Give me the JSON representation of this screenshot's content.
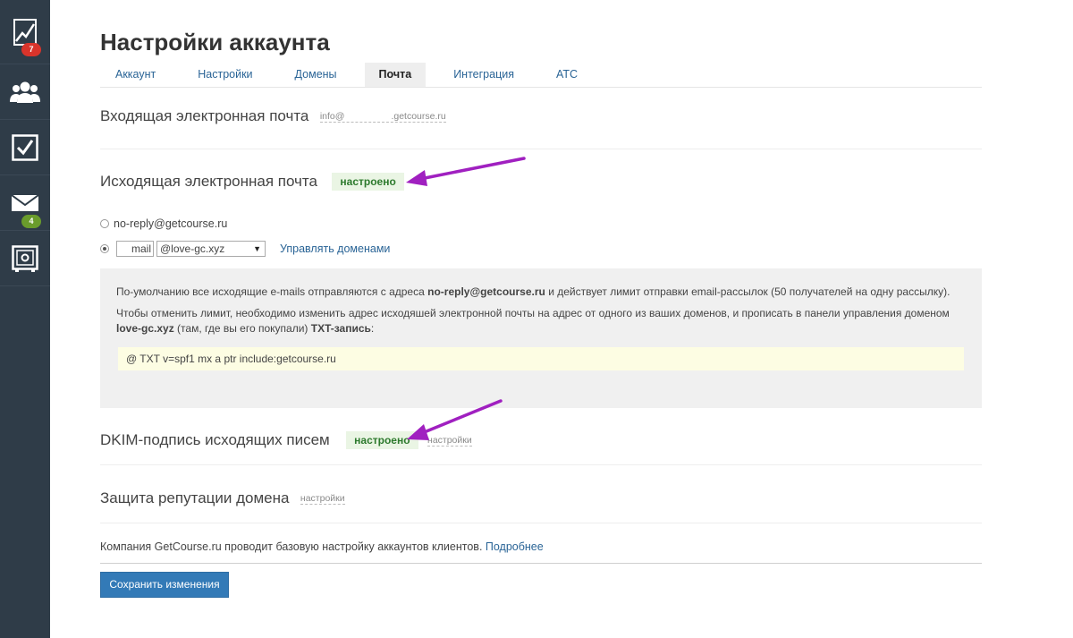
{
  "sidebar": {
    "items": [
      {
        "icon": "chart-icon",
        "badge": "7"
      },
      {
        "icon": "users-icon",
        "badge": ""
      },
      {
        "icon": "checkbox-icon",
        "badge": ""
      },
      {
        "icon": "mail-icon",
        "badge": "4"
      },
      {
        "icon": "safe-icon",
        "badge": ""
      }
    ]
  },
  "page": {
    "title": "Настройки аккаунта"
  },
  "tabs": [
    "Аккаунт",
    "Настройки",
    "Домены",
    "Почта",
    "Интеграция",
    "АТС"
  ],
  "active_tab": "Почта",
  "incoming": {
    "title": "Входящая электронная почта",
    "address_prefix": "info@",
    "address_suffix": ".getcourse.ru"
  },
  "outgoing": {
    "title": "Исходящая электронная почта",
    "status": "настроено",
    "option_default": "no-reply@getcourse.ru",
    "mail_value": "mail",
    "domain_selected": "@love-gc.xyz",
    "manage_link": "Управлять доменами"
  },
  "info": {
    "p1_a": "По-умолчанию все исходящие e-mails отправляются с адреса ",
    "p1_b": "no-reply@getcourse.ru",
    "p1_c": " и действует лимит отправки email-рассылок (50 получателей на одну рассылку).",
    "p2_a": "Чтобы отменить лимит, необходимо изменить адрес исходяшей электронной почты на адрес от одного из ваших доменов, и прописать в панели управления доменом ",
    "p2_b": "love-gc.xyz",
    "p2_c": " (там, где вы его покупали) ",
    "p2_d": "TXT-запись",
    "p2_e": ":",
    "txt_record": "@ TXT v=spf1 mx a ptr include:getcourse.ru"
  },
  "dkim": {
    "title": "DKIM-подпись исходящих писем",
    "status": "настроено",
    "link": "настройки"
  },
  "reputation": {
    "title": "Защита репутации домена",
    "link": "настройки"
  },
  "footer": {
    "note": "Компания GetCourse.ru проводит базовую настройку аккаунтов клиентов. ",
    "more_link": "Подробнее",
    "save_button": "Сохранить изменения"
  },
  "colors": {
    "sidebar": "#2f3c48",
    "accent": "#337ab7",
    "annotation_arrow": "#a020c0",
    "status_green": "#2d7a2d"
  }
}
